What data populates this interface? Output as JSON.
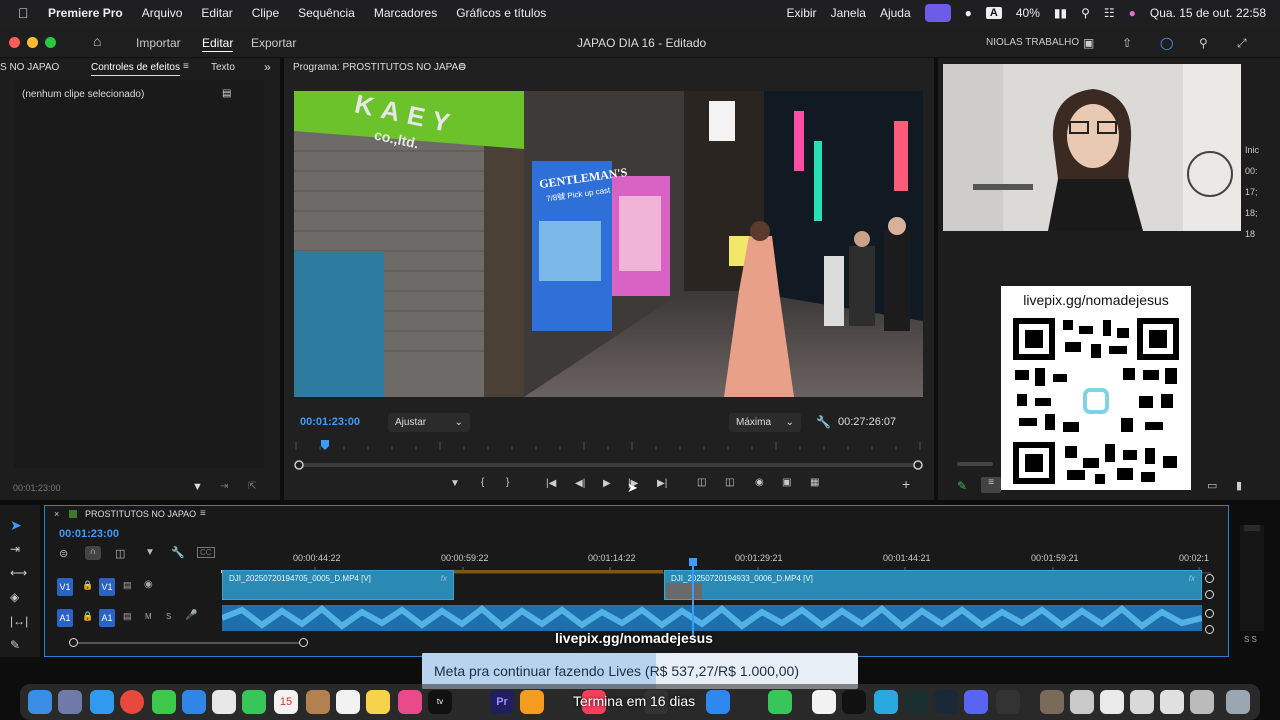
{
  "menubar": {
    "app_name": "Premiere Pro",
    "menus": [
      "Arquivo",
      "Editar",
      "Clipe",
      "Sequência",
      "Marcadores",
      "Gráficos e títulos"
    ],
    "right_menus": [
      "Exibir",
      "Janela",
      "Ajuda"
    ],
    "battery": "40%",
    "datetime": "Qua. 15 de out.  22:58",
    "input_source": "A"
  },
  "titlebar": {
    "nav_items": [
      "Importar",
      "Editar",
      "Exportar"
    ],
    "project_title": "JAPAO DIA 16 - Editado",
    "workspace": "NIOLAS TRABALHO"
  },
  "left_panel": {
    "tab_partial": "S NO JAPAO",
    "tab_effects": "Controles de efeitos",
    "tab_text": "Texto",
    "empty_msg": "(nenhum clipe selecionado)",
    "timecode": "00:01:23:00"
  },
  "program": {
    "tab_label": "Programa: PROSTITUTOS NO JAPAO",
    "timecode": "00:01:23:00",
    "fit_label": "Ajustar",
    "quality_label": "Máxima",
    "duration": "00:27:26:07",
    "sign_top": "KAEY",
    "sign_sub": "co.,ltd.",
    "screen_title": "GENTLEMAN'S",
    "screen_sub": "7/8號 Pick up cast"
  },
  "overlay": {
    "qr_url": "livepix.gg/nomadejesus",
    "banner_url": "livepix.gg/nomadejesus",
    "goal_text": "Meta pra continuar fazendo Lives (R$ 537,27/R$ 1.000,00)",
    "goal_progress": 0.537,
    "ends_text": "Termina em 16 dias"
  },
  "right_edge": {
    "items": [
      "Inic",
      "00:",
      "17;",
      "18;",
      "18"
    ]
  },
  "timeline": {
    "sequence_name": "PROSTITUTOS NO JAPAO",
    "timecode": "00:01:23:00",
    "ruler": [
      "00:00:44:22",
      "00:00:59:22",
      "00:01:14:22",
      "00:01:29:21",
      "00:01:44:21",
      "00:01:59:21",
      "00:02:1"
    ],
    "clip1": "DJI_20250720194705_0005_D.MP4 [V]",
    "clip2": "DJI_20250720194933_0006_D.MP4 [V]",
    "tracks": {
      "v1": "V1",
      "a1": "A1",
      "m": "M",
      "s": "S"
    },
    "meter_label": "S S"
  },
  "colors": {
    "accent": "#2f7bd6",
    "timecode": "#3d9bff",
    "clip_video": "#2a8ab3",
    "clip_audio": "#1d6fae"
  }
}
